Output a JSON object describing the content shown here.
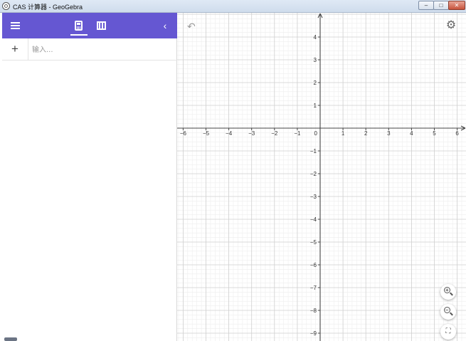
{
  "window": {
    "title": "CAS 计算器 - GeoGebra",
    "controls": {
      "minimize": "–",
      "maximize": "□",
      "close": "✕"
    }
  },
  "toolbar": {
    "menu_icon": "hamburger-menu-icon",
    "tabs": [
      {
        "name": "algebra",
        "icon": "calculator-icon",
        "active": true
      },
      {
        "name": "table",
        "icon": "table-icon",
        "active": false
      }
    ],
    "collapse_icon": "chevron-left-icon",
    "collapse_glyph": "‹",
    "accent_color": "#6557d2"
  },
  "algebra": {
    "add_glyph": "+",
    "input": {
      "placeholder": "输入...",
      "value": ""
    }
  },
  "graphics": {
    "undo_glyph": "↶",
    "settings_glyph": "⚙",
    "fullscreen_glyph": "⛶",
    "x_range": [
      -6.2,
      6.5
    ],
    "y_range": [
      -9.2,
      5
    ],
    "grid_minor_step": 0.2,
    "grid_major_step": 1,
    "x_ticks": [
      "−6",
      "−5",
      "−4",
      "−3",
      "−2",
      "−1",
      "0",
      "1",
      "2",
      "3",
      "4",
      "5",
      "6"
    ],
    "y_ticks": [
      "4",
      "3",
      "2",
      "1",
      "−1",
      "−2",
      "−3",
      "−4",
      "−5",
      "−6",
      "−7",
      "−8",
      "−9"
    ],
    "origin_label": "0"
  }
}
